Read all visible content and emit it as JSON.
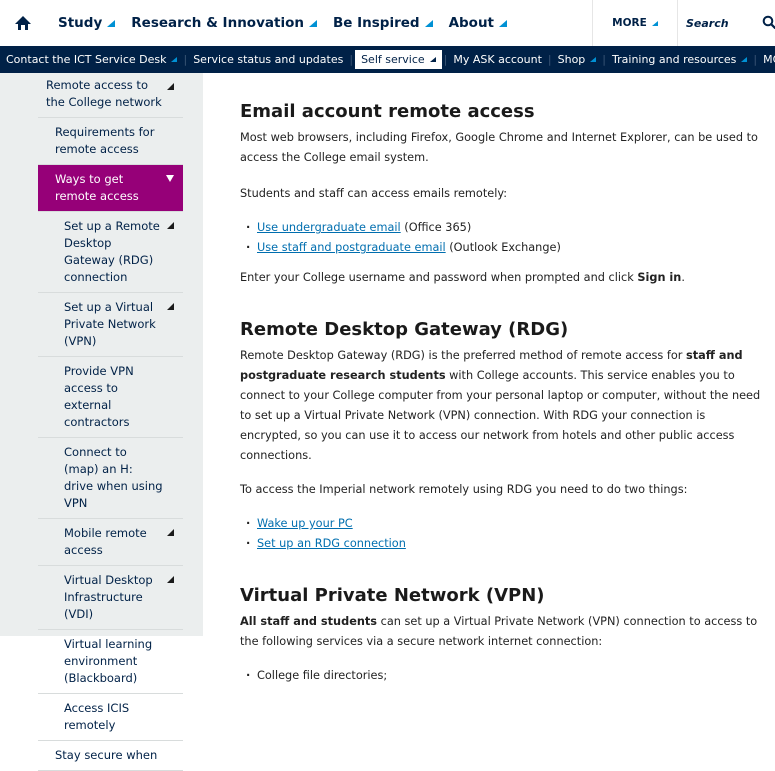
{
  "header": {
    "nav": [
      "Study",
      "Research & Innovation",
      "Be Inspired",
      "About"
    ],
    "more_label": "MORE",
    "search_placeholder": "Search"
  },
  "subnav": {
    "items": [
      {
        "label": "Contact the ICT Service Desk",
        "has_dropdown": true
      },
      {
        "label": "Service status and updates",
        "has_dropdown": false
      },
      {
        "label": "Self service",
        "has_dropdown": true,
        "active": true
      },
      {
        "label": "My ASK account",
        "has_dropdown": false
      },
      {
        "label": "Shop",
        "has_dropdown": true
      },
      {
        "label": "Training and resources",
        "has_dropdown": true
      },
      {
        "label": "MORE",
        "has_dropdown": true
      }
    ]
  },
  "sidebar": {
    "items": [
      {
        "label": "Remote access to the College network",
        "level": 1,
        "arrow": "right"
      },
      {
        "label": "Requirements for remote access",
        "level": 2,
        "arrow": ""
      },
      {
        "label": "Ways to get remote access",
        "level": 2,
        "arrow": "down",
        "active": true
      },
      {
        "label": "Set up a Remote Desktop Gateway (RDG) connection",
        "level": 3,
        "arrow": "right"
      },
      {
        "label": "Set up a Virtual Private Network (VPN)",
        "level": 3,
        "arrow": "right"
      },
      {
        "label": "Provide VPN access to external contractors",
        "level": 3,
        "arrow": ""
      },
      {
        "label": "Connect to (map) an H: drive when using VPN",
        "level": 3,
        "arrow": ""
      },
      {
        "label": "Mobile remote access",
        "level": 3,
        "arrow": "right"
      },
      {
        "label": "Virtual Desktop Infrastructure (VDI)",
        "level": 3,
        "arrow": "right"
      },
      {
        "label": "Virtual learning environment (Blackboard)",
        "level": 3,
        "arrow": ""
      },
      {
        "label": "Access ICIS remotely",
        "level": 3,
        "arrow": ""
      },
      {
        "label": "Stay secure when",
        "level": 2,
        "arrow": ""
      }
    ]
  },
  "content": {
    "email": {
      "title": "Email account remote access",
      "intro": "Most web browsers, including Firefox, Google Chrome and Internet Explorer, can be used to access the College email system.",
      "students_text": "Students and staff can access emails remotely:",
      "link1": "Use undergraduate email",
      "link1_suffix": " (Office 365)",
      "link2": "Use staff and postgraduate email",
      "link2_suffix": " (Outlook Exchange)",
      "enter_text": "Enter your College username and password when prompted and click ",
      "enter_bold": "Sign in",
      "enter_end": "."
    },
    "rdg": {
      "title": "Remote Desktop Gateway (RDG)",
      "p1_a": "Remote Desktop Gateway (RDG) is the preferred method of remote access for ",
      "p1_bold": "staff and postgraduate research students",
      "p1_b": " with College accounts. This service enables you to connect to your College computer from your personal laptop or computer, without the need to set up a Virtual Private Network (VPN) connection. With RDG your connection is encrypted, so you can use it to access our network from hotels and other public access connections.",
      "p2": "To access the Imperial network remotely using RDG you need to do two things:",
      "link1": "Wake up your PC",
      "link2": "Set up an RDG connection"
    },
    "vpn": {
      "title": "Virtual Private Network (VPN)",
      "p1_bold": "All staff and students",
      "p1_rest": " can set up a Virtual Private Network (VPN) connection to access to the following services via a secure network internet connection:",
      "item1": "College file directories;"
    }
  },
  "colors": {
    "navy": "#002147",
    "accent_blue": "#0091d4",
    "active_magenta": "#960078",
    "link": "#006eaf",
    "sidebar_bg": "#ebeeee"
  }
}
